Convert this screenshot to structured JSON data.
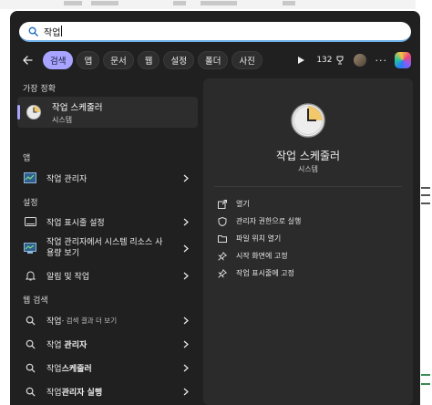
{
  "search": {
    "query": "작업"
  },
  "tabs": [
    "검색",
    "앱",
    "문서",
    "웹",
    "설정",
    "폴더",
    "사진"
  ],
  "toolbar": {
    "points": "132"
  },
  "sections": {
    "best_match": "가장 정확",
    "apps": "앱",
    "settings": "설정",
    "web": "웹 검색"
  },
  "best_match": {
    "title": "작업 스케줄러",
    "subtitle": "시스템"
  },
  "apps": [
    {
      "label": "작업 관리자"
    }
  ],
  "settings": [
    {
      "label": "작업 표시줄 설정"
    },
    {
      "label_line1": "작업 관리자에서 시스템 리소스 사",
      "label_line2": "용량 보기"
    },
    {
      "label": "알림 및 작업"
    }
  ],
  "web": [
    {
      "label": "작업",
      "extra": " - 검색 결과 더 보기"
    },
    {
      "label_prefix": "작업 ",
      "label_bold": "관리자"
    },
    {
      "label_prefix": "작업",
      "label_bold": "스케줄러"
    },
    {
      "label_prefix": "작업",
      "label_bold": "관리자 실행"
    }
  ],
  "detail": {
    "title": "작업 스케줄러",
    "subtitle": "시스템",
    "actions": [
      "열기",
      "관리자 권한으로 실행",
      "파일 위치 열기",
      "시작 화면에 고정",
      "작업 표시줄에 고정"
    ]
  },
  "colors": {
    "accent": "#a8a4ff",
    "panel": "#202020",
    "detail_bg": "#2b2b2b"
  }
}
